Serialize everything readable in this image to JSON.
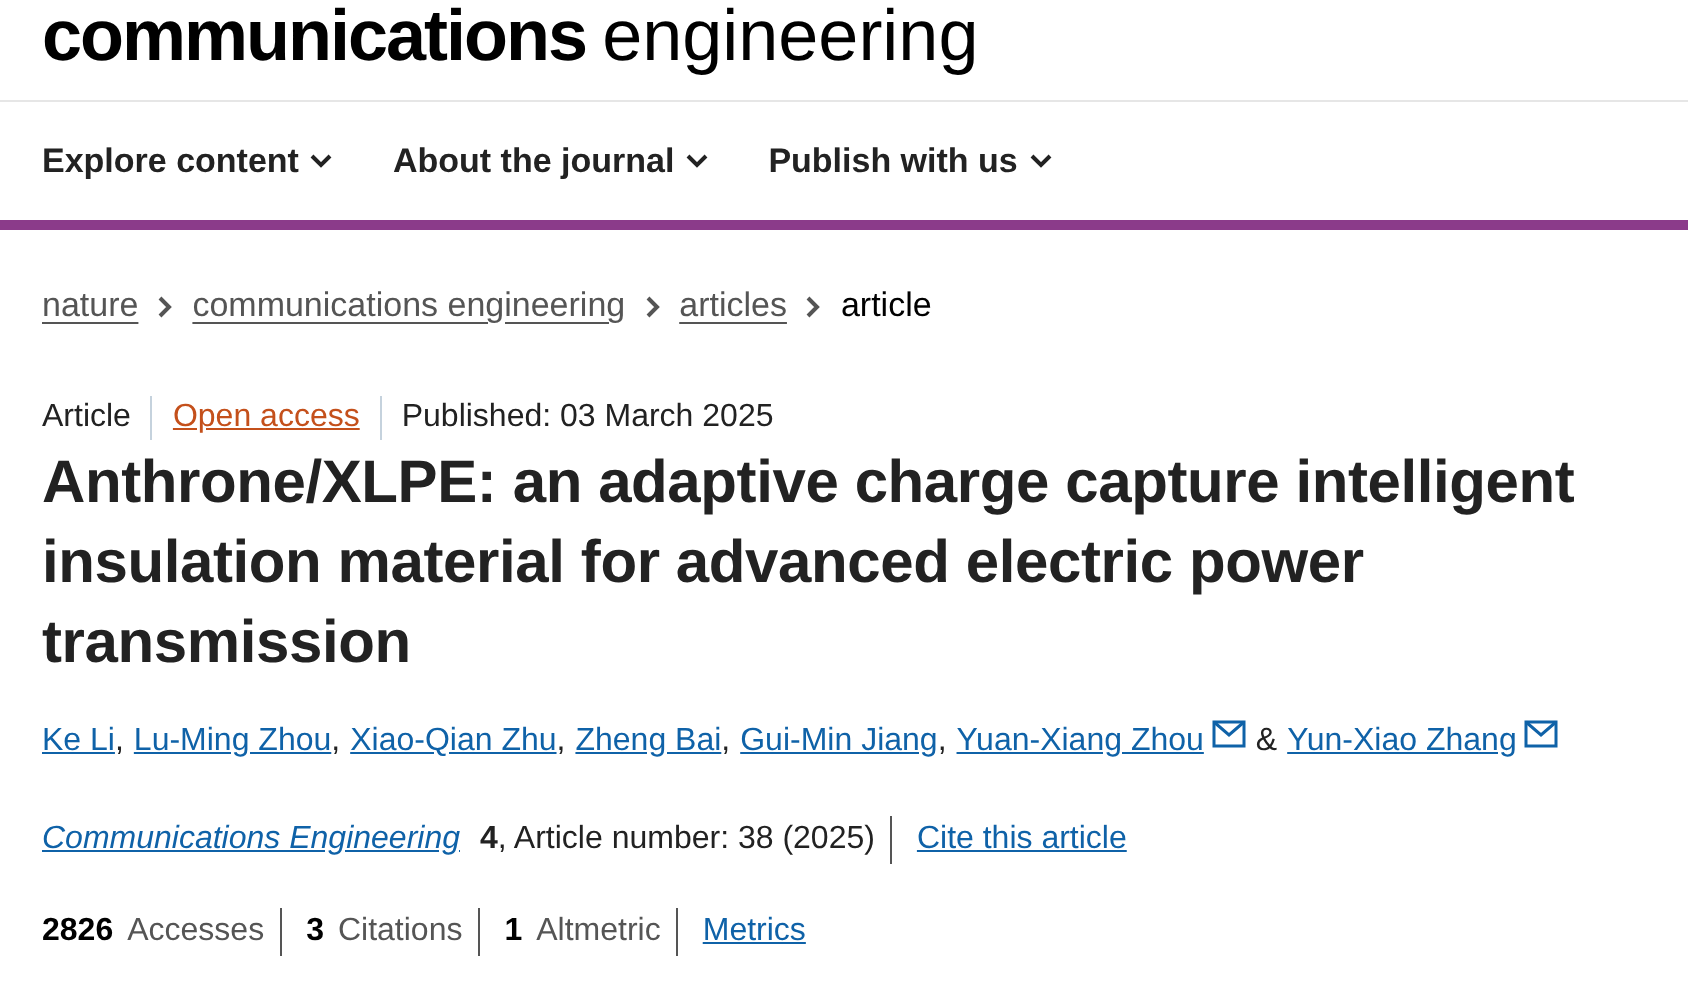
{
  "logo": {
    "bold": "communications",
    "light": "engineering"
  },
  "nav": [
    {
      "label": "Explore content"
    },
    {
      "label": "About the journal"
    },
    {
      "label": "Publish with us"
    }
  ],
  "breadcrumbs": [
    {
      "label": "nature",
      "link": true
    },
    {
      "label": "communications engineering",
      "link": true
    },
    {
      "label": "articles",
      "link": true
    },
    {
      "label": "article",
      "link": false
    }
  ],
  "meta": {
    "type": "Article",
    "access": "Open access",
    "published": "Published: 03 March 2025"
  },
  "title": "Anthrone/XLPE: an adaptive charge capture intelligent insulation material for advanced electric power transmission",
  "authors": [
    {
      "name": "Ke Li",
      "email": false,
      "after": ","
    },
    {
      "name": "Lu-Ming Zhou",
      "email": false,
      "after": ","
    },
    {
      "name": "Xiao-Qian Zhu",
      "email": false,
      "after": ","
    },
    {
      "name": "Zheng Bai",
      "email": false,
      "after": ","
    },
    {
      "name": "Gui-Min Jiang",
      "email": false,
      "after": ","
    },
    {
      "name": "Yuan-Xiang Zhou",
      "email": true,
      "after": "&"
    },
    {
      "name": "Yun-Xiao Zhang",
      "email": true
    }
  ],
  "citation": {
    "journal": "Communications Engineering",
    "volume": "4",
    "rest": ", Article number: 38 (2025)",
    "cite": "Cite this article"
  },
  "metrics": [
    {
      "count": "2826",
      "name": "Accesses"
    },
    {
      "count": "3",
      "name": "Citations"
    },
    {
      "count": "1",
      "name": "Altmetric"
    }
  ],
  "metrics_link": "Metrics"
}
